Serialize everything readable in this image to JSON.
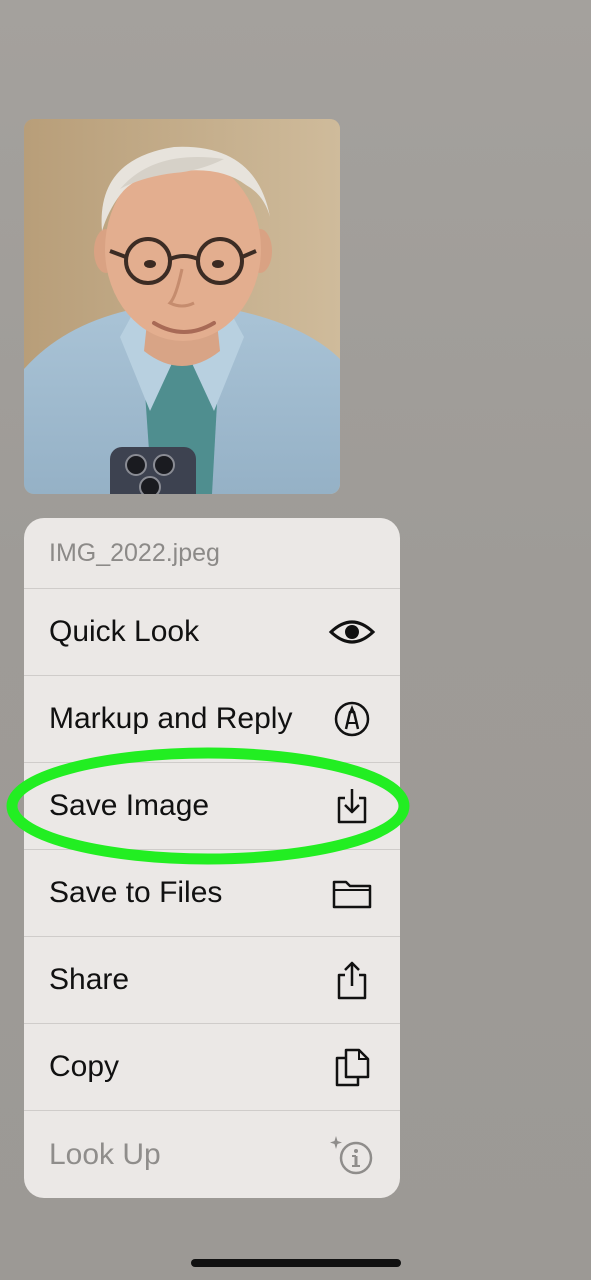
{
  "menu": {
    "title": "IMG_2022.jpeg",
    "items": [
      {
        "label": "Quick Look",
        "icon": "eye-icon",
        "enabled": true
      },
      {
        "label": "Markup and Reply",
        "icon": "markup-pen-icon",
        "enabled": true
      },
      {
        "label": "Save Image",
        "icon": "save-download-icon",
        "enabled": true
      },
      {
        "label": "Save to Files",
        "icon": "folder-icon",
        "enabled": true
      },
      {
        "label": "Share",
        "icon": "share-icon",
        "enabled": true
      },
      {
        "label": "Copy",
        "icon": "copy-documents-icon",
        "enabled": true
      },
      {
        "label": "Look Up",
        "icon": "look-up-sparkle-info-icon",
        "enabled": false
      }
    ]
  },
  "annotation": {
    "highlight_color": "#22ee22",
    "highlighted_item": "Save Image"
  },
  "colors": {
    "background": "#a09d99",
    "menu_background": "#ebe8e6",
    "text_primary": "#111111",
    "text_disabled": "#8f8d8b"
  }
}
